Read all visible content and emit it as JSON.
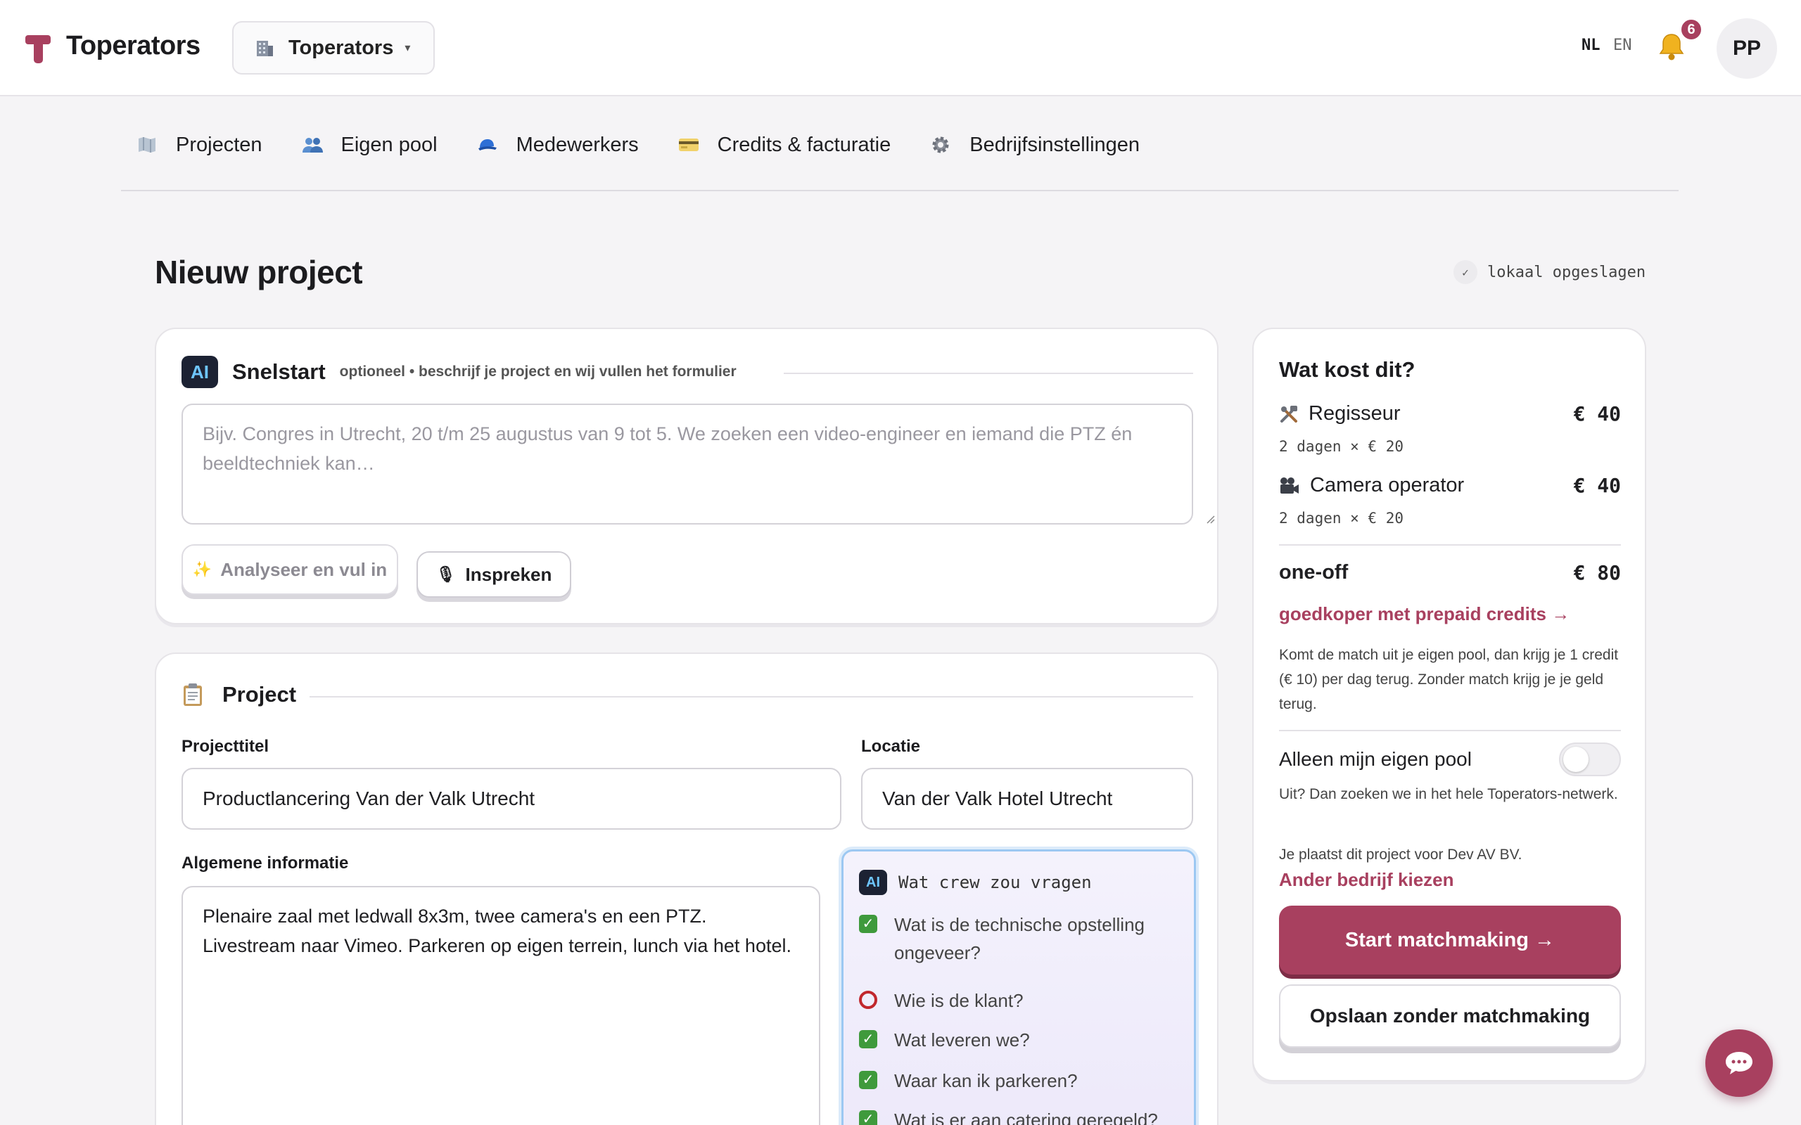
{
  "app": {
    "brand": "Toperators",
    "company_switcher": {
      "icon": "office-building-icon",
      "label": "Toperators",
      "chevron": "▾"
    },
    "languages": {
      "nl": "NL",
      "en": "EN"
    },
    "notifications": {
      "icon": "bell-icon",
      "count": "6"
    },
    "user_initials": "PP",
    "accent_color": "#a8405f"
  },
  "nav": {
    "items": [
      {
        "icon": "map-icon",
        "label": "Projecten"
      },
      {
        "icon": "people-icon",
        "label": "Eigen pool"
      },
      {
        "icon": "cap-icon",
        "label": "Medewerkers"
      },
      {
        "icon": "credit-card-icon",
        "label": "Credits & facturatie"
      },
      {
        "icon": "gear-icon",
        "label": "Bedrijfsinstellingen"
      }
    ]
  },
  "page": {
    "title": "Nieuw project",
    "saved_mark": "✓",
    "saved_status": "lokaal opgeslagen"
  },
  "snelstart": {
    "ai_badge": "AI",
    "title": "Snelstart",
    "subtitle": "optioneel • beschrijf je project en wij vullen het formulier",
    "placeholder": "Bijv. Congres in Utrecht, 20 t/m 25 augustus van 9 tot 5. We zoeken een video-engineer en iemand die PTZ én beeldtechniek kan…",
    "analyse_icon": "✨",
    "analyse_label": "Analyseer en vul in",
    "speak_icon": "🎙",
    "speak_label": "Inspreken"
  },
  "project": {
    "icon": "clipboard-icon",
    "title": "Project",
    "title_label": "Projecttitel",
    "title_value": "Productlancering Van der Valk Utrecht",
    "location_label": "Locatie",
    "location_value": "Van der Valk Hotel Utrecht",
    "info_label": "Algemene informatie",
    "info_value": "Plenaire zaal met ledwall 8x3m, twee camera's en een PTZ. Livestream naar Vimeo. Parkeren op eigen terrein, lunch via het hotel.",
    "crew": {
      "ai_badge": "AI",
      "title": "Wat crew zou vragen",
      "questions": [
        {
          "status": "done",
          "mark": "✓",
          "text": "Wat is de technische opstelling ongeveer?"
        },
        {
          "status": "open",
          "text": "Wie is de klant?"
        },
        {
          "status": "done",
          "mark": "✓",
          "text": "Wat leveren we?"
        },
        {
          "status": "done",
          "mark": "✓",
          "text": "Waar kan ik parkeren?"
        },
        {
          "status": "done",
          "mark": "✓",
          "text": "Wat is er aan catering geregeld?"
        }
      ]
    }
  },
  "cost": {
    "title": "Wat kost dit?",
    "items": [
      {
        "icon": "tools-icon",
        "name": "Regisseur",
        "amount": "€ 40",
        "detail": "2 dagen × € 20"
      },
      {
        "icon": "video-camera-icon",
        "name": "Camera operator",
        "amount": "€ 40",
        "detail": "2 dagen × € 20"
      }
    ],
    "total_label": "one-off",
    "total_amount": "€ 80",
    "prepaid_link": "goedkoper met prepaid credits →",
    "pool_note": "Komt de match uit je eigen pool, dan krijg je 1 credit (€ 10) per dag terug. Zonder match krijg je je geld terug.",
    "own_pool_label": "Alleen mijn eigen pool",
    "own_pool_on": false,
    "own_pool_hint": "Uit? Dan zoeken we in het hele Toperators-netwerk.",
    "company_note": "Je plaatst dit project voor Dev AV BV.",
    "change_company": "Ander bedrijf kiezen",
    "start_button": "Start matchmaking →",
    "save_button": "Opslaan zonder matchmaking"
  },
  "chat": {
    "icon": "chat-bubble-icon"
  }
}
